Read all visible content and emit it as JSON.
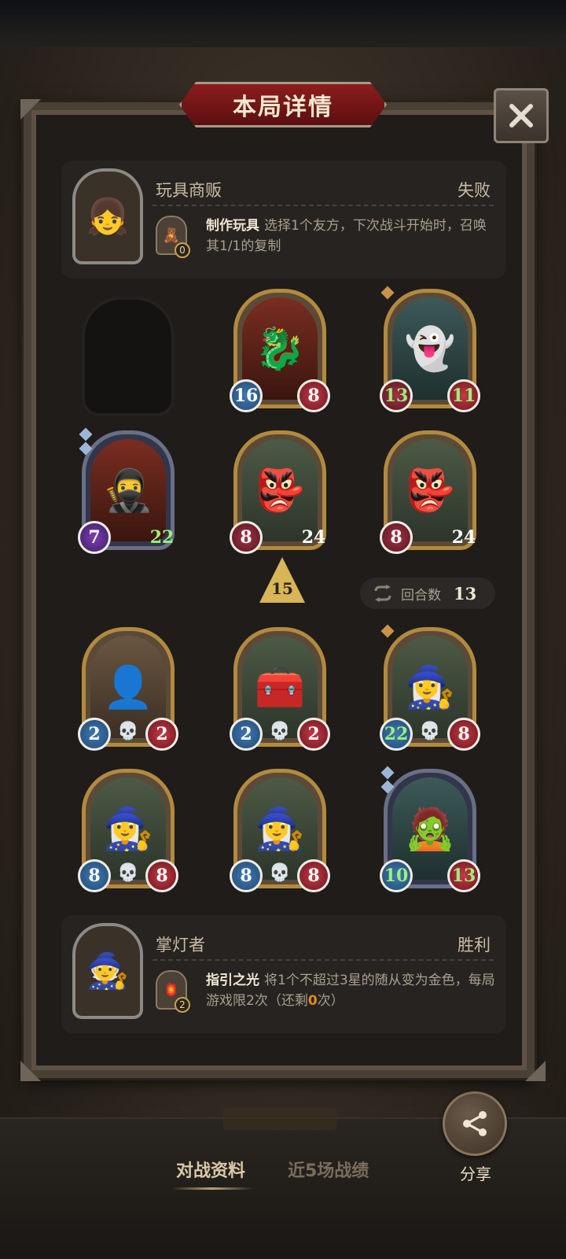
{
  "title": "本局详情",
  "close_icon": "close-icon",
  "top_player": {
    "name": "玩具商贩",
    "result": "失败",
    "skill": {
      "name": "制作玩具",
      "desc_a": "选择1个友方，下次战斗开始时，召唤其1/1的复制",
      "uses": "0"
    }
  },
  "round": {
    "label": "回合数",
    "value": "13"
  },
  "level": "15",
  "units_row1": [
    {
      "atk": "16",
      "hp": "8"
    },
    {
      "atk": "13",
      "hp": "11"
    }
  ],
  "units_row2": [
    {
      "atk": "7",
      "hp": "22"
    },
    {
      "atk": "8",
      "hp": "24"
    },
    {
      "atk": "8",
      "hp": "24"
    }
  ],
  "units_row3": [
    {
      "atk": "2",
      "hp": "2"
    },
    {
      "atk": "2",
      "hp": "2"
    },
    {
      "atk": "22",
      "hp": "8"
    }
  ],
  "units_row4": [
    {
      "atk": "8",
      "hp": "8"
    },
    {
      "atk": "8",
      "hp": "8"
    },
    {
      "atk": "10",
      "hp": "13"
    }
  ],
  "bottom_player": {
    "name": "掌灯者",
    "result": "胜利",
    "skill": {
      "name": "指引之光",
      "desc_a": "将1个不超过3星的随从变为金色，每局游戏限2次（还剩",
      "remaining": "0",
      "desc_b": "次）",
      "uses": "2"
    }
  },
  "share_label": "分享",
  "tabs": [
    "对战资料",
    "近5场战绩"
  ]
}
